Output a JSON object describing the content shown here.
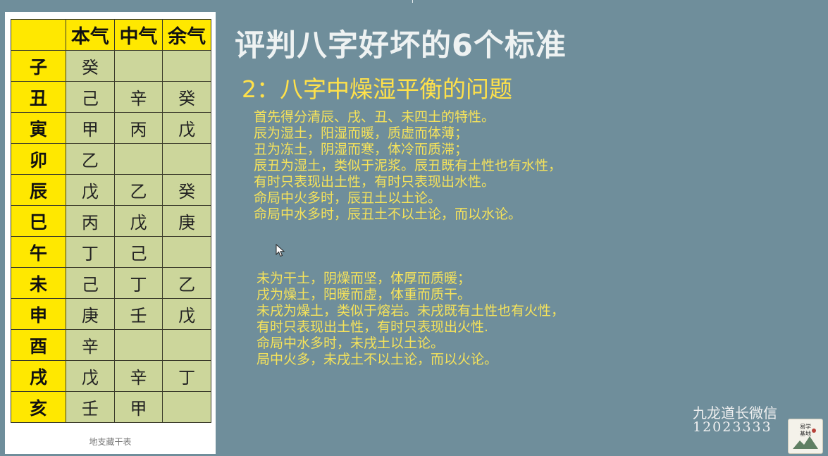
{
  "table": {
    "headers": [
      "",
      "本气",
      "中气",
      "余气"
    ],
    "rows": [
      [
        "子",
        "癸",
        "",
        ""
      ],
      [
        "丑",
        "己",
        "辛",
        "癸"
      ],
      [
        "寅",
        "甲",
        "丙",
        "戊"
      ],
      [
        "卯",
        "乙",
        "",
        ""
      ],
      [
        "辰",
        "戊",
        "乙",
        "癸"
      ],
      [
        "巳",
        "丙",
        "戊",
        "庚"
      ],
      [
        "午",
        "丁",
        "己",
        ""
      ],
      [
        "未",
        "己",
        "丁",
        "乙"
      ],
      [
        "申",
        "庚",
        "壬",
        "戊"
      ],
      [
        "酉",
        "辛",
        "",
        ""
      ],
      [
        "戌",
        "戊",
        "辛",
        "丁"
      ],
      [
        "亥",
        "壬",
        "甲",
        ""
      ]
    ],
    "caption": "地支藏干表"
  },
  "slide": {
    "title": "评判八字好坏的6个标准",
    "subtitle": "2：八字中燥湿平衡的问题",
    "paragraph1": [
      "首先得分清辰、戌、丑、未四土的特性。",
      "辰为湿土，阳湿而暖，质虚而体薄；",
      "丑为冻土，阴湿而寒，体冷而质滞；",
      "辰丑为湿土，类似于泥浆。辰丑既有土性也有水性，",
      "有时只表现出土性，有时只表现出水性。",
      "命局中火多时，辰丑土以土论。",
      "命局中水多时，辰丑土不以土论，而以水论。"
    ],
    "paragraph2": [
      "未为干土，阴燥而坚，体厚而质暖；",
      "戌为燥土，阳暖而虚，体重而质干。",
      "未戌为燥土，类似于熔岩。未戌既有土性也有火性，",
      "有时只表现出土性，有时只表现出火性.",
      "命局中水多时，未戌土以土论。",
      "局中火多，未戌土不以土论，而以火论。"
    ]
  },
  "watermark": {
    "label": "九龙道长微信",
    "number": "12023333",
    "seal_text": [
      "易学",
      "基地"
    ]
  },
  "colors": {
    "background": "#6f8e9b",
    "header_yellow": "#ffe800",
    "cell_green": "#ccd69b",
    "text_yellow": "#f6e35a"
  }
}
